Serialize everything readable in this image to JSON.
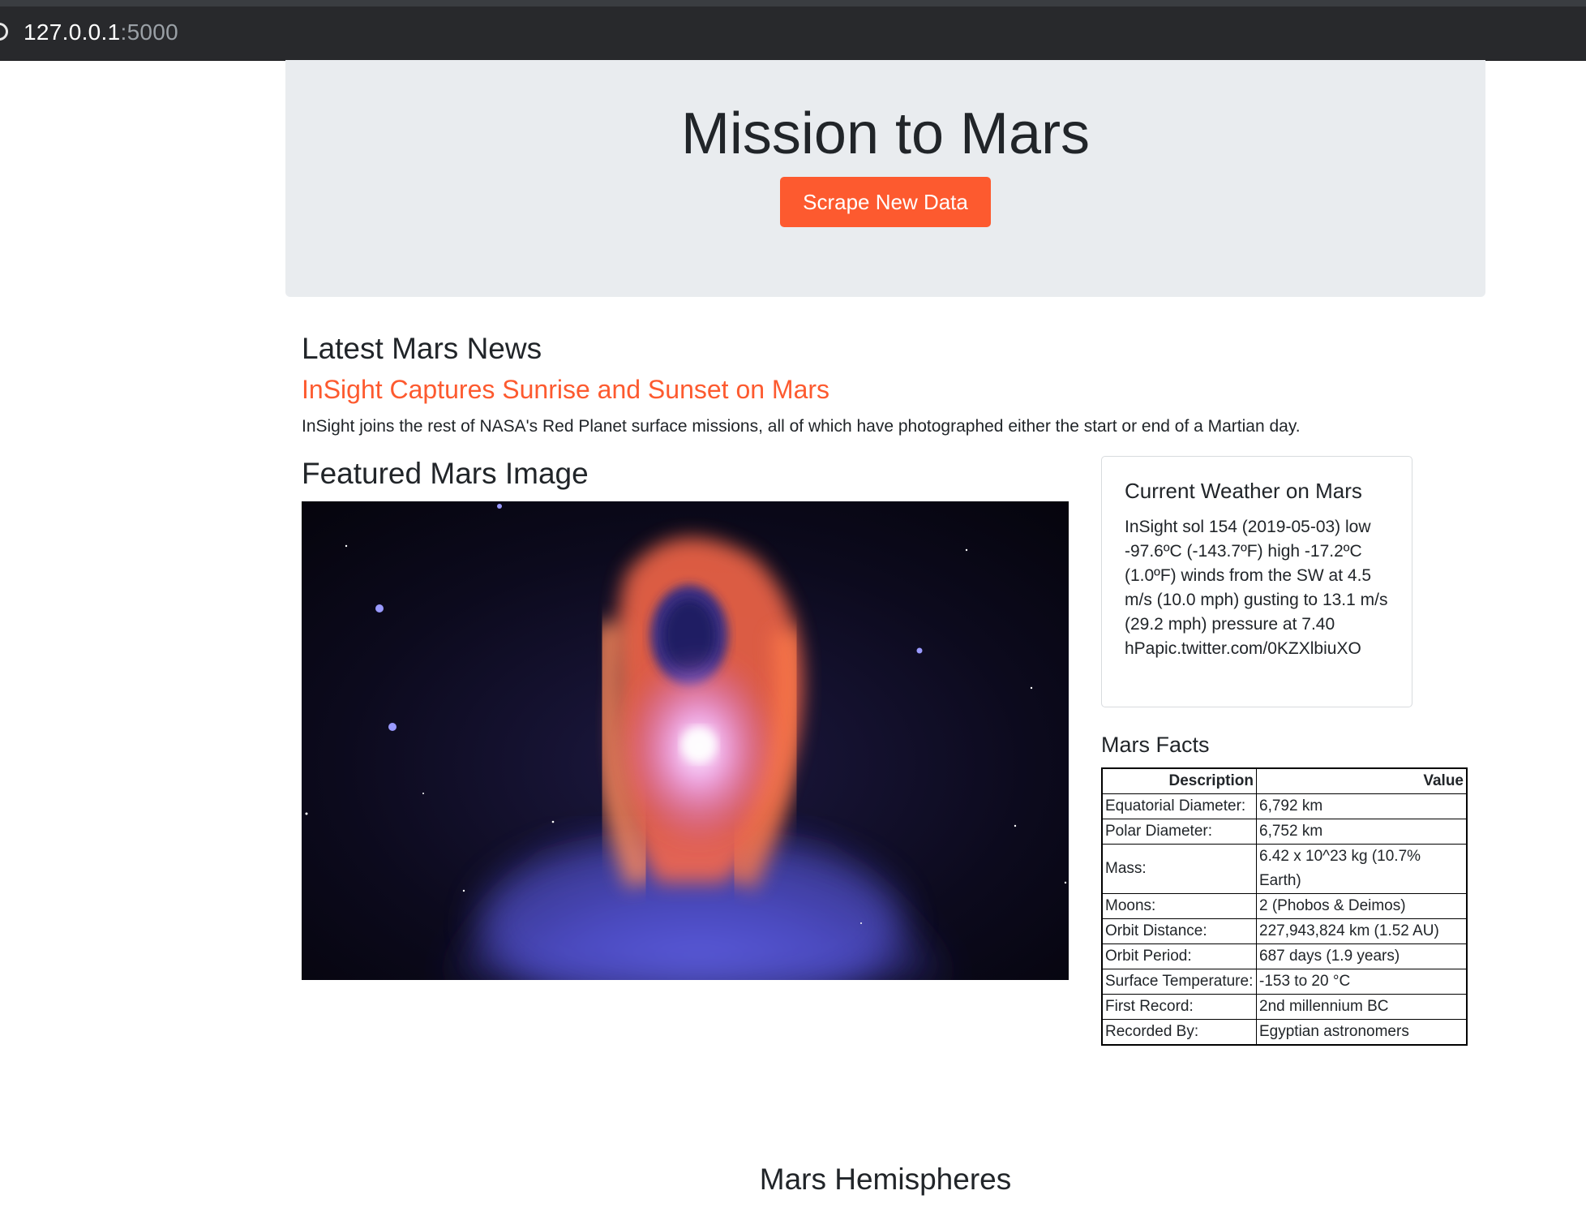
{
  "browser": {
    "host": "127.0.0.1",
    "port": ":5000"
  },
  "header": {
    "title": "Mission to Mars",
    "scrape_button": "Scrape New Data"
  },
  "news": {
    "heading": "Latest Mars News",
    "title": "InSight Captures Sunrise and Sunset on Mars",
    "paragraph": "InSight joins the rest of NASA's Red Planet surface missions, all of which have photographed either the start or end of a Martian day."
  },
  "featured": {
    "heading": "Featured Mars Image"
  },
  "weather": {
    "heading": "Current Weather on Mars",
    "text": "InSight sol 154 (2019-05-03) low -97.6ºC (-143.7ºF) high -17.2ºC (1.0ºF) winds from the SW at 4.5 m/s (10.0 mph) gusting to 13.1 m/s (29.2 mph) pressure at 7.40 hPapic.twitter.com/0KZXlbiuXO"
  },
  "facts": {
    "heading": "Mars Facts",
    "columns": [
      "Description",
      "Value"
    ],
    "rows": [
      [
        "Equatorial Diameter:",
        "6,792 km"
      ],
      [
        "Polar Diameter:",
        "6,752 km"
      ],
      [
        "Mass:",
        "6.42 x 10^23 kg (10.7% Earth)"
      ],
      [
        "Moons:",
        "2 (Phobos & Deimos)"
      ],
      [
        "Orbit Distance:",
        "227,943,824 km (1.52 AU)"
      ],
      [
        "Orbit Period:",
        "687 days (1.9 years)"
      ],
      [
        "Surface Temperature:",
        "-153 to 20 °C"
      ],
      [
        "First Record:",
        "2nd millennium BC"
      ],
      [
        "Recorded By:",
        "Egyptian astronomers"
      ]
    ]
  },
  "hemispheres": {
    "heading": "Mars Hemispheres"
  },
  "colors": {
    "accent": "#fd5a2f",
    "jumbotron_bg": "#e9ecef",
    "browser_bar": "#28292c"
  }
}
